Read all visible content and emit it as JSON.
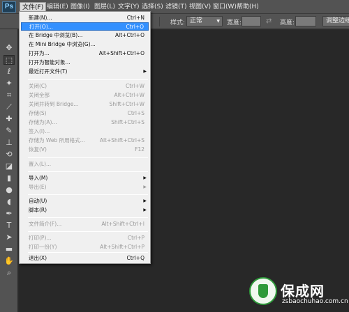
{
  "menubar": {
    "logo": "Ps",
    "items": [
      "文件(F)",
      "编辑(E)",
      "图像(I)",
      "图层(L)",
      "文字(Y)",
      "选择(S)",
      "滤镜(T)",
      "视图(V)",
      "窗口(W)",
      "帮助(H)"
    ]
  },
  "options_bar": {
    "style_label": "样式:",
    "style_value": "正常",
    "width_label": "宽度:",
    "height_label": "高度:",
    "refine_button": "调整边缘"
  },
  "file_menu": {
    "items": [
      {
        "label": "新建(N)...",
        "shortcut": "Ctrl+N"
      },
      {
        "label": "打开(O)...",
        "shortcut": "Ctrl+O"
      },
      {
        "label": "在 Bridge 中浏览(B)...",
        "shortcut": "Alt+Ctrl+O"
      },
      {
        "label": "在 Mini Bridge 中浏览(G)...",
        "shortcut": ""
      },
      {
        "label": "打开为...",
        "shortcut": "Alt+Shift+Ctrl+O"
      },
      {
        "label": "打开为智能对象...",
        "shortcut": ""
      },
      {
        "label": "最近打开文件(T)",
        "shortcut": ""
      },
      {
        "label": "关闭(C)",
        "shortcut": "Ctrl+W"
      },
      {
        "label": "关闭全部",
        "shortcut": "Alt+Ctrl+W"
      },
      {
        "label": "关闭并转到 Bridge...",
        "shortcut": "Shift+Ctrl+W"
      },
      {
        "label": "存储(S)",
        "shortcut": "Ctrl+S"
      },
      {
        "label": "存储为(A)...",
        "shortcut": "Shift+Ctrl+S"
      },
      {
        "label": "签入(I)...",
        "shortcut": ""
      },
      {
        "label": "存储为 Web 所用格式...",
        "shortcut": "Alt+Shift+Ctrl+S"
      },
      {
        "label": "恢复(V)",
        "shortcut": "F12"
      },
      {
        "label": "置入(L)...",
        "shortcut": ""
      },
      {
        "label": "导入(M)",
        "shortcut": ""
      },
      {
        "label": "导出(E)",
        "shortcut": ""
      },
      {
        "label": "自动(U)",
        "shortcut": ""
      },
      {
        "label": "脚本(R)",
        "shortcut": ""
      },
      {
        "label": "文件简介(F)...",
        "shortcut": "Alt+Shift+Ctrl+I"
      },
      {
        "label": "打印(P)...",
        "shortcut": "Ctrl+P"
      },
      {
        "label": "打印一份(Y)",
        "shortcut": "Alt+Shift+Ctrl+P"
      },
      {
        "label": "退出(X)",
        "shortcut": "Ctrl+Q"
      }
    ]
  },
  "watermark": {
    "title": "保成网",
    "url": "zsbaochuhao.com.cn"
  }
}
